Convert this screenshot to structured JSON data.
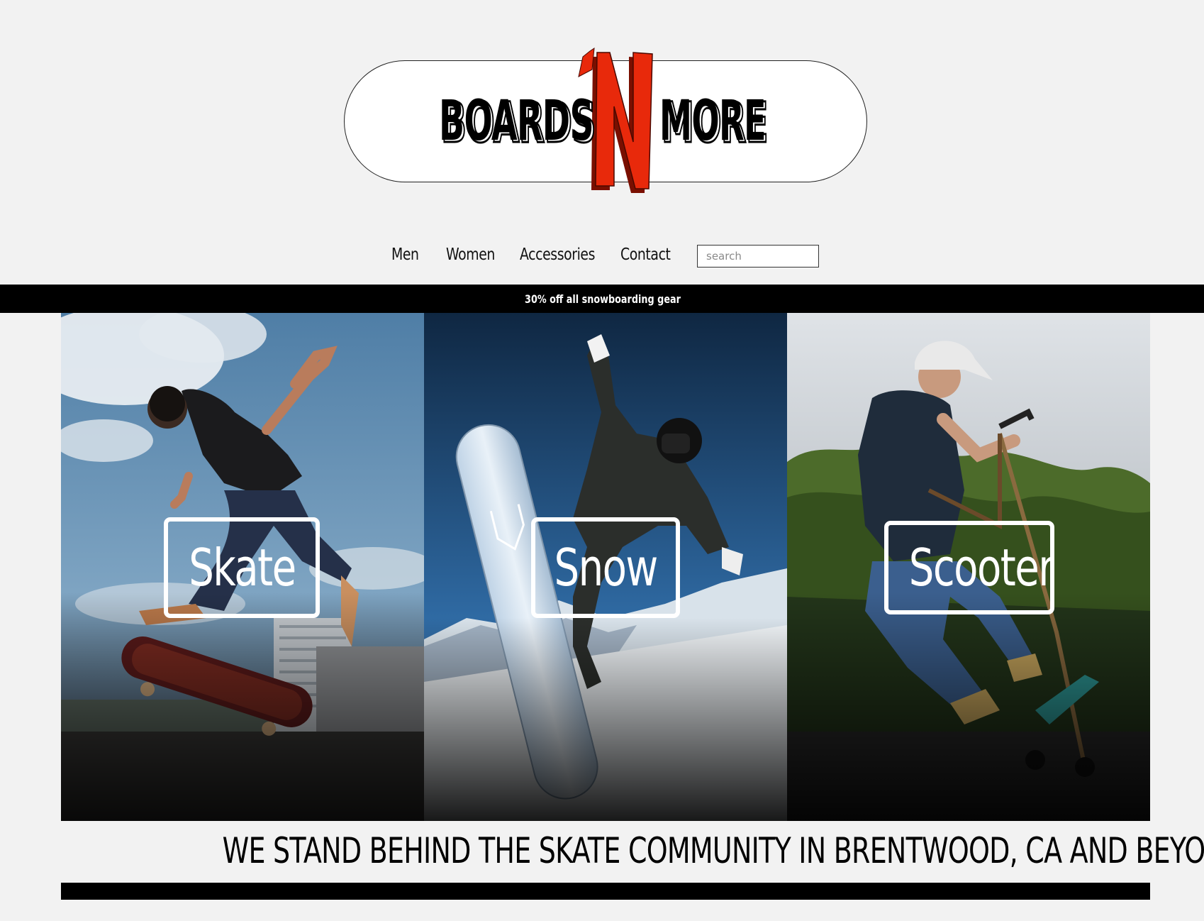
{
  "logo": {
    "text_left": "BOARDS",
    "text_mid": "N",
    "apostrophe": "‘",
    "text_right": "MORE",
    "accent_color": "#e8290b"
  },
  "nav": {
    "items": [
      {
        "label": "Men"
      },
      {
        "label": "Women"
      },
      {
        "label": "Accessories"
      },
      {
        "label": "Contact"
      }
    ],
    "search_placeholder": "search"
  },
  "promo": {
    "text": "30% off all snowboarding gear"
  },
  "categories": [
    {
      "label": "Skate"
    },
    {
      "label": "Snow"
    },
    {
      "label": "Scooter"
    }
  ],
  "tagline": "WE STAND BEHIND THE SKATE COMMUNITY IN BRENTWOOD, CA AND BEYOND"
}
